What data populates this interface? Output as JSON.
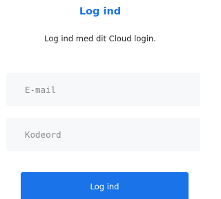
{
  "login": {
    "title": "Log ind",
    "subtitle": "Log ind med dit Cloud login.",
    "email": {
      "value": "",
      "placeholder": "E-mail"
    },
    "password": {
      "value": "",
      "placeholder": "Kodeord"
    },
    "submit_label": "Log ind"
  },
  "colors": {
    "accent": "#1a73e8",
    "field_background": "#f7f8fa"
  }
}
